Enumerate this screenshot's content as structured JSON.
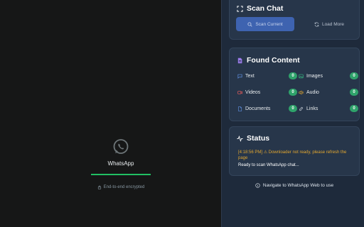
{
  "whatsapp": {
    "title": "WhatsApp",
    "encrypted_text": "End-to-end encrypted",
    "progress": 1.0,
    "brand_color": "#21c063"
  },
  "scan": {
    "title": "Scan Chat",
    "scan_button": "Scan Current",
    "load_more_button": "Load More"
  },
  "found": {
    "title": "Found Content",
    "items": [
      {
        "label": "Text",
        "count": "0",
        "icon": "message-icon"
      },
      {
        "label": "Images",
        "count": "0",
        "icon": "image-icon"
      },
      {
        "label": "Videos",
        "count": "0",
        "icon": "video-icon"
      },
      {
        "label": "Audio",
        "count": "0",
        "icon": "audio-icon"
      },
      {
        "label": "Documents",
        "count": "0",
        "icon": "document-icon"
      },
      {
        "label": "Links",
        "count": "0",
        "icon": "link-icon"
      }
    ]
  },
  "status": {
    "title": "Status",
    "timestamp": "[4:18:56 PM]",
    "warning": "Downloader not ready, please refresh the page",
    "ready_message": "Ready to scan WhatsApp chat..."
  },
  "footer": {
    "note": "Navigate to WhatsApp Web to use"
  },
  "colors": {
    "accent": "#3e63b0",
    "badge": "#2fa36b",
    "warning": "#e3a72f",
    "panel": "#1e2a3b"
  }
}
